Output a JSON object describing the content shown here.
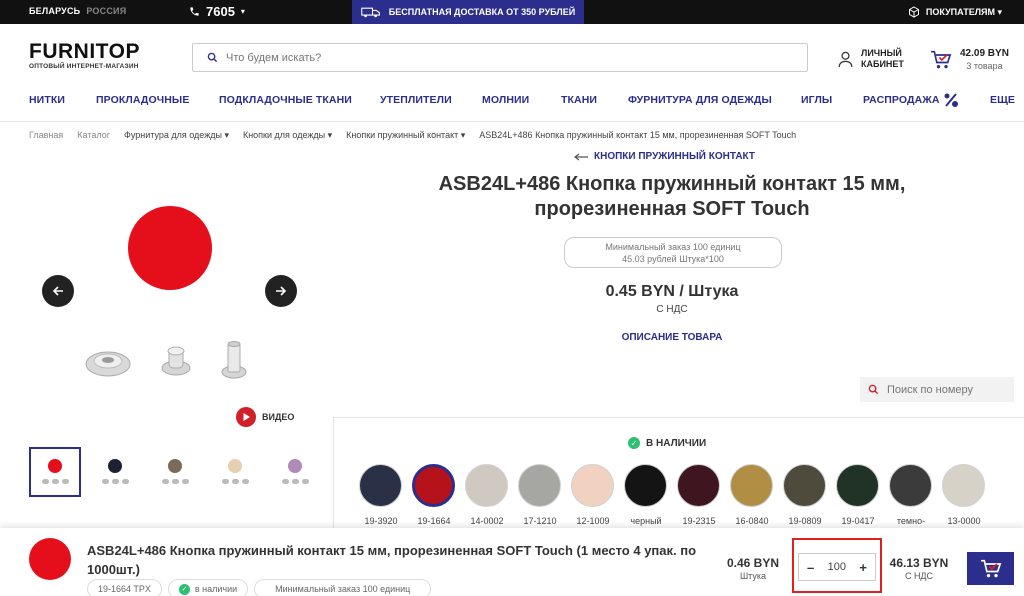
{
  "topbar": {
    "region_active": "БЕЛАРУСЬ",
    "region_alt": "РОССИЯ",
    "phone": "7605",
    "promo": "БЕСПЛАТНАЯ ДОСТАВКА ОТ 350 РУБЛЕЙ",
    "buyers": "ПОКУПАТЕЛЯМ ▾"
  },
  "header": {
    "logo": "FURNITOP",
    "logo_sub": "ОПТОВЫЙ ИНТЕРНЕТ-МАГАЗИН",
    "search_placeholder": "Что будем искать?",
    "account_line1": "ЛИЧНЫЙ",
    "account_line2": "КАБИНЕТ",
    "cart_sum": "42.09 BYN",
    "cart_count": "3 товара"
  },
  "nav": [
    "НИТКИ",
    "ПРОКЛАДОЧНЫЕ",
    "ПОДКЛАДОЧНЫЕ ТКАНИ",
    "УТЕПЛИТЕЛИ",
    "МОЛНИИ",
    "ТКАНИ",
    "ФУРНИТУРА ДЛЯ ОДЕЖДЫ",
    "ИГЛЫ",
    "РАСПРОДАЖА",
    "ЕЩЕ"
  ],
  "breadcrumb": [
    "Главная",
    "Каталог",
    "Фурнитура для одежды ▾",
    "Кнопки для одежды ▾",
    "Кнопки пружинный контакт ▾",
    "ASB24L+486 Кнопка пружинный контакт 15 мм, прорезиненная SOFT Touch"
  ],
  "product": {
    "back_link": "КНОПКИ ПРУЖИННЫЙ КОНТАКТ",
    "title_line1": "ASB24L+486 Кнопка пружинный контакт 15 мм,",
    "title_line2": "прорезиненная SOFT Touch",
    "min_order_line1": "Минимальный заказ 100 единиц",
    "min_order_line2": "45.03 рублей Штука*100",
    "price": "0.45 BYN / Штука",
    "vat": "С НДС",
    "description_link": "ОПИСАНИЕ ТОВАРА",
    "video_label": "ВИДЕО",
    "number_search_placeholder": "Поиск по номеру",
    "stock": "В НАЛИЧИИ",
    "main_color": "#e50f1c"
  },
  "thumbs": [
    {
      "color": "#e50f1c"
    },
    {
      "color": "#1c2233"
    },
    {
      "color": "#7a6a58"
    },
    {
      "color": "#e8cfb0"
    },
    {
      "color": "#b08ab8"
    }
  ],
  "colors": [
    {
      "code": "19-3920",
      "hex": "#2a3147"
    },
    {
      "code": "19-1664",
      "hex": "#b5121b"
    },
    {
      "code": "14-0002",
      "hex": "#cfc9c1"
    },
    {
      "code": "17-1210",
      "hex": "#a6a6a3"
    },
    {
      "code": "12-1009",
      "hex": "#f1d2c0"
    },
    {
      "code": "черный",
      "hex": "#141414"
    },
    {
      "code": "19-2315",
      "hex": "#3f1620"
    },
    {
      "code": "16-0840",
      "hex": "#b08f45"
    },
    {
      "code": "19-0809",
      "hex": "#4e4a3c"
    },
    {
      "code": "19-0417",
      "hex": "#213227"
    },
    {
      "code": "темно-",
      "hex": "#3b3b3b"
    },
    {
      "code": "13-0000",
      "hex": "#d7d2c8"
    }
  ],
  "sticky": {
    "title": "ASB24L+486 Кнопка пружинный контакт 15 мм, прорезиненная SOFT Touch (1 место 4 упак. по 1000шт.)",
    "tag_code": "19-1664 TPX",
    "tag_stock": "в наличии",
    "tag_min": "Минимальный заказ 100 единиц",
    "unit_price": "0.46 BYN",
    "unit_label": "Штука",
    "qty_minus": "–",
    "qty": "100",
    "qty_plus": "+",
    "total": "46.13 BYN",
    "total_label": "С НДС"
  }
}
